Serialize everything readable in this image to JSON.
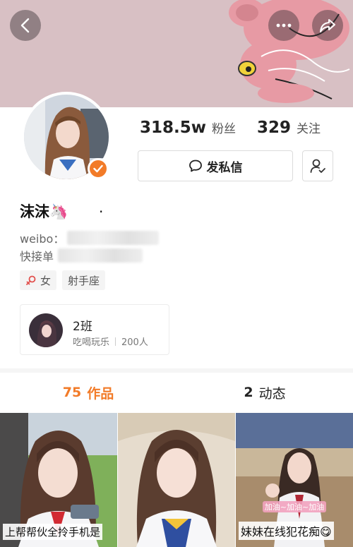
{
  "nav": {
    "back_icon": "chevron-left-icon",
    "more_icon": "more-dots-icon",
    "share_icon": "share-arrow-icon"
  },
  "profile": {
    "name": "沫沫🦄",
    "verified_icon": "check-badge-icon",
    "weibo_label": "weibo：",
    "kuaijie_label": "快接单"
  },
  "stats": {
    "fans_count": "318.5w",
    "fans_label": "粉丝",
    "follow_count": "329",
    "follow_label": "关注"
  },
  "actions": {
    "message_label": "发私信",
    "message_icon": "chat-bubble-icon",
    "follow_icon": "user-check-icon"
  },
  "tags": [
    "女",
    "射手座"
  ],
  "group": {
    "name": "2班",
    "category": "吃喝玩乐",
    "members": "200人"
  },
  "tabs": {
    "works_count": "75",
    "works_label": "作品",
    "dynamics_count": "2",
    "dynamics_label": "动态"
  },
  "posts": [
    {
      "caption": "上帮帮伙全拎手机是"
    },
    {
      "caption": ""
    },
    {
      "caption": "妹妹在线犯花痴😋",
      "overlay": "加油~加油~加油"
    }
  ],
  "colors": {
    "accent": "#f27b28",
    "banner": "#d8c0c4"
  }
}
